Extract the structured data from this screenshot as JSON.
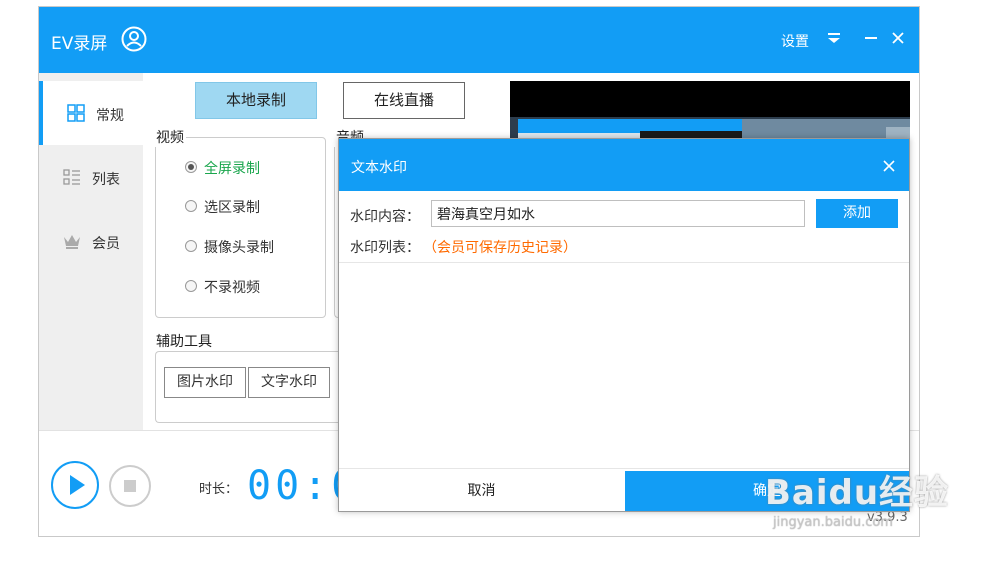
{
  "app": {
    "title": "EV录屏",
    "settings_label": "设置",
    "version": "v3.9.3",
    "colors": {
      "accent": "#129df5",
      "success": "#1aa64d",
      "warning": "#ff6a00"
    }
  },
  "sidebar": {
    "items": [
      {
        "label": "常规",
        "icon": "grid-icon",
        "active": true
      },
      {
        "label": "列表",
        "icon": "list-icon",
        "active": false
      },
      {
        "label": "会员",
        "icon": "crown-icon",
        "active": false
      }
    ]
  },
  "tabs": {
    "local": "本地录制",
    "live": "在线直播"
  },
  "video": {
    "title": "视频",
    "options": [
      {
        "label": "全屏录制",
        "checked": true
      },
      {
        "label": "选区录制",
        "checked": false
      },
      {
        "label": "摄像头录制",
        "checked": false
      },
      {
        "label": "不录视频",
        "checked": false
      }
    ]
  },
  "audio": {
    "title": "音频"
  },
  "tools": {
    "title": "辅助工具",
    "buttons": [
      "图片水印",
      "文字水印"
    ]
  },
  "recording": {
    "duration_label": "时长：",
    "timer": "00:0"
  },
  "dialog": {
    "title": "文本水印",
    "content_label": "水印内容：",
    "content_value": "碧海真空月如水",
    "add_label": "添加",
    "list_label": "水印列表：",
    "list_note": "（会员可保存历史记录）",
    "cancel_label": "取消",
    "ok_label": "确定"
  },
  "watermark": {
    "logo": "Baidu经验",
    "url": "jingyan.baidu.com"
  }
}
